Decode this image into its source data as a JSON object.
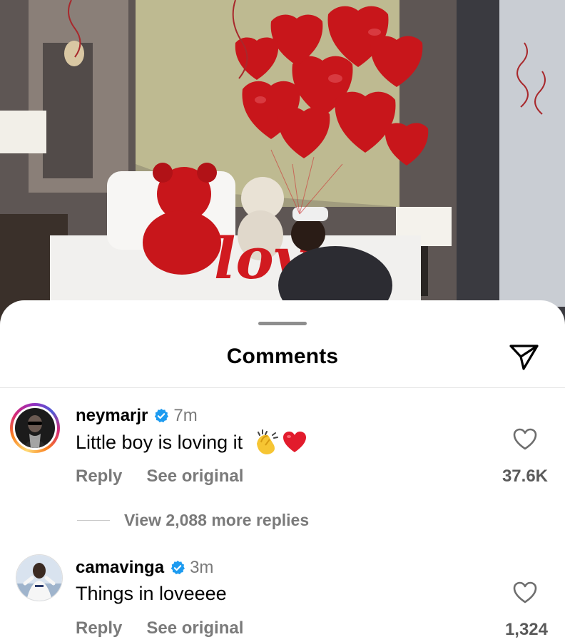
{
  "header": {
    "title": "Comments"
  },
  "icons": {
    "share": "paper-plane-icon",
    "heart": "heart-outline-icon",
    "verified": "verified-badge-icon"
  },
  "colors": {
    "verified": "#1d9bf0",
    "muted": "#7a7a7a"
  },
  "comments": [
    {
      "username": "neymarjr",
      "time": "7m",
      "text": "Little boy is loving it",
      "emojis": [
        "clapping-hands",
        "red-heart"
      ],
      "reply_label": "Reply",
      "see_original_label": "See original",
      "likes": "37.6K",
      "has_story_ring": true
    },
    {
      "username": "camavinga",
      "time": "3m",
      "text": "Things in loveeee",
      "reply_label": "Reply",
      "see_original_label": "See original",
      "likes": "1,324",
      "has_story_ring": false
    }
  ],
  "replies": {
    "label": "View 2,088 more replies"
  }
}
